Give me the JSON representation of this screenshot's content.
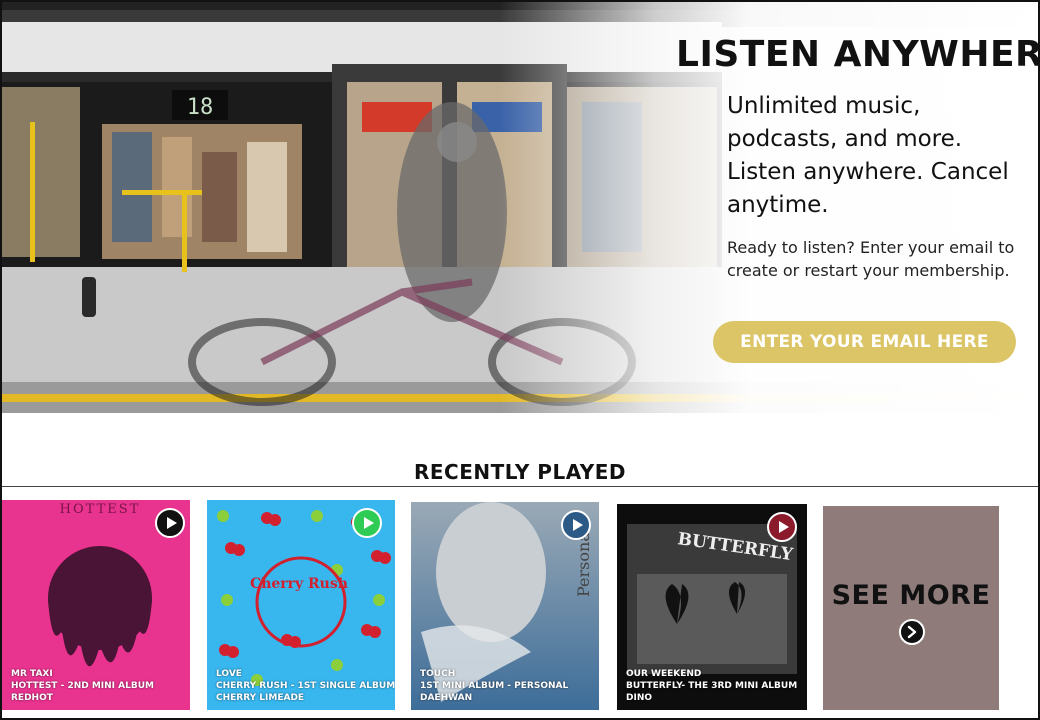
{
  "hero": {
    "title": "LISTEN ANYWHERE",
    "lead": "Unlimited music, podcasts, and more. Listen anywhere. Cancel anytime.",
    "sub": "Ready to listen? Enter your email to create or restart your membership.",
    "email_button": "ENTER YOUR EMAIL HERE",
    "train_number": "18"
  },
  "recent": {
    "title": "RECENTLY PLAYED",
    "items": [
      {
        "song": "MR TAXI",
        "album": "HOTTEST - 2ND MINI ALBUM",
        "artist": "REDHOT",
        "cover_text": "HOTTEST",
        "play_color": "#111111"
      },
      {
        "song": "LOVE",
        "album": "CHERRY RUSH - 1ST SINGLE ALBUM",
        "artist": "CHERRY LIMEADE",
        "cover_text": "Cherry Rush",
        "play_color": "#2ecc55"
      },
      {
        "song": "TOUCH",
        "album": "1ST MINI ALBUM - PERSONAL",
        "artist": "DAEHWAN",
        "cover_text": "Personal",
        "play_color": "#2b5a86"
      },
      {
        "song": "OUR WEEKEND",
        "album": "BUTTERFLY- THE 3RD MINI ALBUM",
        "artist": "DINO",
        "cover_text": "BUTTERFLY",
        "play_color": "#8b1a2a"
      }
    ],
    "see_more": "SEE MORE"
  },
  "colors": {
    "accent_gold": "#dcc566",
    "see_more_bg": "#8e7b7a"
  }
}
